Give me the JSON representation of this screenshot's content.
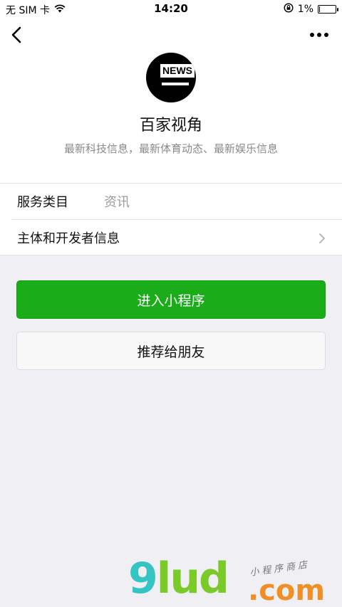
{
  "status_bar": {
    "carrier": "无 SIM 卡",
    "time": "14:20",
    "battery_percent": "1%",
    "icons": [
      "wifi-icon",
      "orientation-lock-icon",
      "battery-icon"
    ]
  },
  "nav": {
    "back_icon": "chevron-left-icon",
    "more_icon": "more-dots-icon"
  },
  "profile": {
    "logo_text": "NEWS",
    "name": "百家视角",
    "description": "最新科技信息，最新体育动态、最新娱乐信息"
  },
  "info_rows": [
    {
      "label": "服务类目",
      "value": "资讯"
    },
    {
      "label": "主体和开发者信息",
      "value": ""
    }
  ],
  "buttons": {
    "enter": "进入小程序",
    "recommend": "推荐给朋友"
  },
  "colors": {
    "primary_green": "#1aad19",
    "page_bg": "#efeff4"
  },
  "watermark": {
    "nine": "9",
    "lud": "lud",
    "com": ".com",
    "sub": "小程序商店"
  }
}
